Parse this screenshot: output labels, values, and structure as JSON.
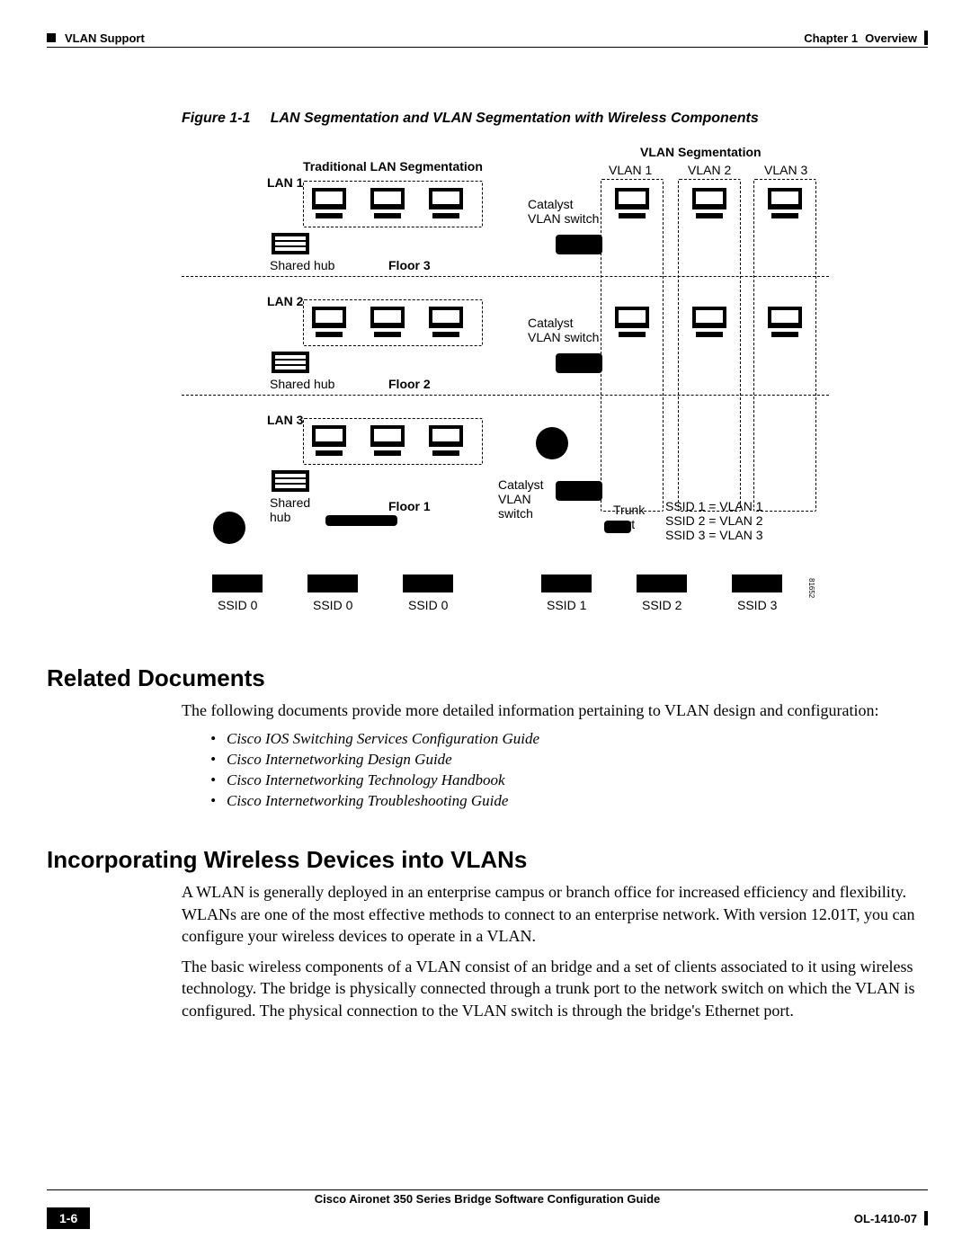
{
  "header": {
    "section": "VLAN Support",
    "chapter_label": "Chapter 1",
    "chapter_title": "Overview"
  },
  "figure": {
    "caption_label": "Figure 1-1",
    "caption_text": "LAN Segmentation and VLAN Segmentation with Wireless Components",
    "left_title": "Traditional LAN Segmentation",
    "right_title": "VLAN Segmentation",
    "vlan_labels": [
      "VLAN 1",
      "VLAN 2",
      "VLAN 3"
    ],
    "lans": [
      "LAN 1",
      "LAN 2",
      "LAN 3"
    ],
    "floors": [
      "Floor 3",
      "Floor 2",
      "Floor 1"
    ],
    "shared_hub": "Shared hub",
    "shared_hub_stack": "Shared\nhub",
    "catalyst": "Catalyst\nVLAN switch",
    "catalyst_stack": "Catalyst\nVLAN\nswitch",
    "trunk": "Trunk\nport",
    "ssid_map": [
      "SSID 1 = VLAN 1",
      "SSID 2 = VLAN 2",
      "SSID 3 = VLAN 3"
    ],
    "left_ssids": [
      "SSID 0",
      "SSID 0",
      "SSID 0"
    ],
    "right_ssids": [
      "SSID 1",
      "SSID 2",
      "SSID 3"
    ],
    "drawing_id": "81652"
  },
  "sections": {
    "related_docs_title": "Related Documents",
    "related_docs_intro": "The following documents provide more detailed information pertaining to VLAN design and configuration:",
    "doc_list": [
      "Cisco IOS Switching Services Configuration Guide",
      "Cisco Internetworking Design Guide",
      "Cisco Internetworking Technology Handbook",
      "Cisco Internetworking Troubleshooting Guide"
    ],
    "incorporate_title": "Incorporating Wireless Devices into VLANs",
    "incorporate_p1": "A WLAN is generally deployed in an enterprise campus or branch office for increased efficiency and flexibility. WLANs are one of the most effective methods to connect to an enterprise network. With version 12.01T, you can configure your wireless devices to operate in a VLAN.",
    "incorporate_p2": "The basic wireless components of a VLAN consist of an bridge and a set of clients associated to it using wireless technology. The bridge is physically connected through a trunk port to the network switch on which the VLAN is configured. The physical connection to the VLAN switch is through the bridge's Ethernet port."
  },
  "footer": {
    "book": "Cisco Aironet 350 Series Bridge Software Configuration Guide",
    "page": "1-6",
    "docid": "OL-1410-07"
  }
}
